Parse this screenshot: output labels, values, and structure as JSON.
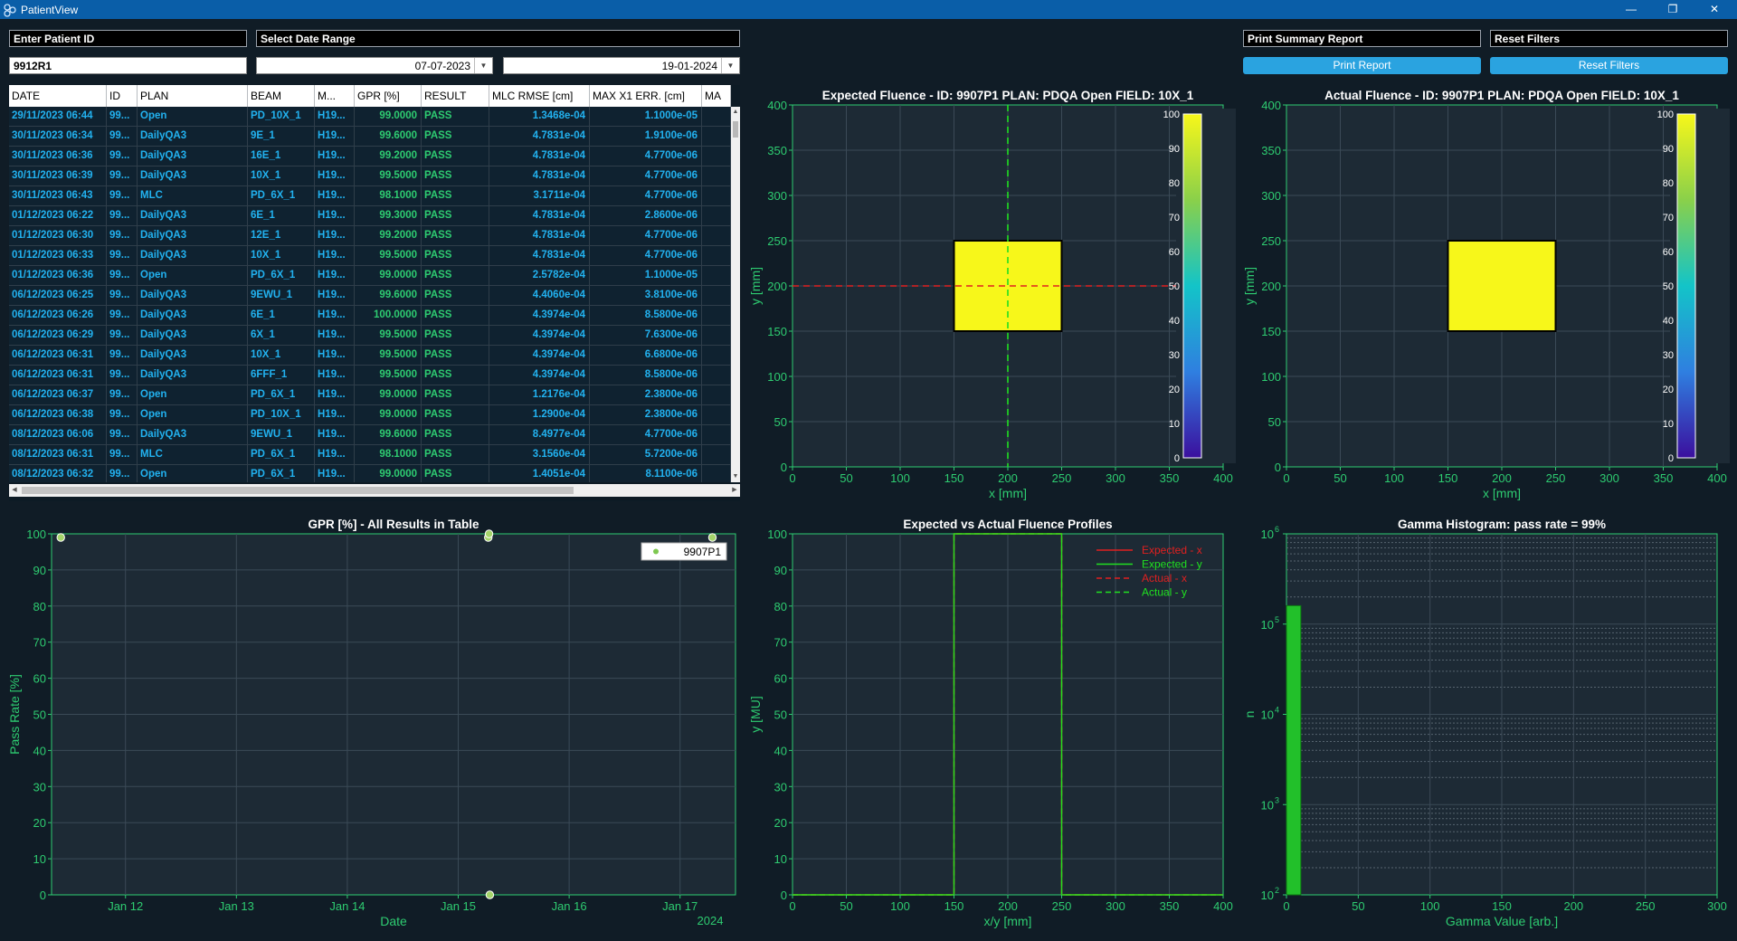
{
  "window": {
    "title": "PatientView"
  },
  "controls": {
    "patient_id_label": "Enter Patient ID",
    "patient_id_value": "9912R1",
    "date_range_label": "Select Date Range",
    "date_start": "07-07-2023",
    "date_end": "19-01-2024",
    "print_summary_label": "Print Summary Report",
    "print_button": "Print Report",
    "reset_label": "Reset Filters",
    "reset_button": "Reset Filters"
  },
  "table": {
    "columns": [
      "DATE",
      "ID",
      "PLAN",
      "BEAM",
      "M...",
      "GPR [%]",
      "RESULT",
      "MLC RMSE [cm]",
      "MAX X1 ERR. [cm]",
      "MA"
    ],
    "rows": [
      [
        "29/11/2023 06:44",
        "99...",
        "Open",
        "PD_10X_1",
        "H19...",
        "99.0000",
        "PASS",
        "1.3468e-04",
        "1.1000e-05"
      ],
      [
        "30/11/2023 06:34",
        "99...",
        "DailyQA3",
        "9E_1",
        "H19...",
        "99.6000",
        "PASS",
        "4.7831e-04",
        "1.9100e-06"
      ],
      [
        "30/11/2023 06:36",
        "99...",
        "DailyQA3",
        "16E_1",
        "H19...",
        "99.2000",
        "PASS",
        "4.7831e-04",
        "4.7700e-06"
      ],
      [
        "30/11/2023 06:39",
        "99...",
        "DailyQA3",
        "10X_1",
        "H19...",
        "99.5000",
        "PASS",
        "4.7831e-04",
        "4.7700e-06"
      ],
      [
        "30/11/2023 06:43",
        "99...",
        "MLC",
        "PD_6X_1",
        "H19...",
        "98.1000",
        "PASS",
        "3.1711e-04",
        "4.7700e-06"
      ],
      [
        "01/12/2023 06:22",
        "99...",
        "DailyQA3",
        "6E_1",
        "H19...",
        "99.3000",
        "PASS",
        "4.7831e-04",
        "2.8600e-06"
      ],
      [
        "01/12/2023 06:30",
        "99...",
        "DailyQA3",
        "12E_1",
        "H19...",
        "99.2000",
        "PASS",
        "4.7831e-04",
        "4.7700e-06"
      ],
      [
        "01/12/2023 06:33",
        "99...",
        "DailyQA3",
        "10X_1",
        "H19...",
        "99.5000",
        "PASS",
        "4.7831e-04",
        "4.7700e-06"
      ],
      [
        "01/12/2023 06:36",
        "99...",
        "Open",
        "PD_6X_1",
        "H19...",
        "99.0000",
        "PASS",
        "2.5782e-04",
        "1.1000e-05"
      ],
      [
        "06/12/2023 06:25",
        "99...",
        "DailyQA3",
        "9EWU_1",
        "H19...",
        "99.6000",
        "PASS",
        "4.4060e-04",
        "3.8100e-06"
      ],
      [
        "06/12/2023 06:26",
        "99...",
        "DailyQA3",
        "6E_1",
        "H19...",
        "100.0000",
        "PASS",
        "4.3974e-04",
        "8.5800e-06"
      ],
      [
        "06/12/2023 06:29",
        "99...",
        "DailyQA3",
        "6X_1",
        "H19...",
        "99.5000",
        "PASS",
        "4.3974e-04",
        "7.6300e-06"
      ],
      [
        "06/12/2023 06:31",
        "99...",
        "DailyQA3",
        "10X_1",
        "H19...",
        "99.5000",
        "PASS",
        "4.3974e-04",
        "6.6800e-06"
      ],
      [
        "06/12/2023 06:31",
        "99...",
        "DailyQA3",
        "6FFF_1",
        "H19...",
        "99.5000",
        "PASS",
        "4.3974e-04",
        "8.5800e-06"
      ],
      [
        "06/12/2023 06:37",
        "99...",
        "Open",
        "PD_6X_1",
        "H19...",
        "99.0000",
        "PASS",
        "1.2176e-04",
        "2.3800e-06"
      ],
      [
        "06/12/2023 06:38",
        "99...",
        "Open",
        "PD_10X_1",
        "H19...",
        "99.0000",
        "PASS",
        "1.2900e-04",
        "2.3800e-06"
      ],
      [
        "08/12/2023 06:06",
        "99...",
        "DailyQA3",
        "9EWU_1",
        "H19...",
        "99.6000",
        "PASS",
        "8.4977e-04",
        "4.7700e-06"
      ],
      [
        "08/12/2023 06:31",
        "99...",
        "MLC",
        "PD_6X_1",
        "H19...",
        "98.1000",
        "PASS",
        "3.1560e-04",
        "5.7200e-06"
      ],
      [
        "08/12/2023 06:32",
        "99...",
        "Open",
        "PD_6X_1",
        "H19...",
        "99.0000",
        "PASS",
        "1.4051e-04",
        "8.1100e-06"
      ]
    ]
  },
  "chart_data": [
    {
      "type": "heatmap",
      "title": "Expected Fluence - ID: 9907P1 PLAN: PDQA Open FIELD: 10X_1",
      "xlabel": "x [mm]",
      "ylabel": "y [mm]",
      "xlim": [
        0,
        400
      ],
      "ylim": [
        0,
        400
      ],
      "xticks": [
        "0",
        "50",
        "100",
        "150",
        "200",
        "250",
        "300",
        "350",
        "400"
      ],
      "yticks": [
        "0",
        "50",
        "100",
        "150",
        "200",
        "250",
        "300",
        "350",
        "400"
      ],
      "field_rect": {
        "x0": 150,
        "x1": 250,
        "y0": 150,
        "y1": 250,
        "value": 100
      },
      "crosshair": {
        "x": 200,
        "y": 200
      },
      "colorbar": {
        "min": 0,
        "max": 100,
        "ticks": [
          "0",
          "10",
          "20",
          "30",
          "40",
          "50",
          "60",
          "70",
          "80",
          "90",
          "100"
        ]
      },
      "grid": true
    },
    {
      "type": "heatmap",
      "title": "Actual Fluence - ID: 9907P1 PLAN: PDQA Open FIELD: 10X_1",
      "xlabel": "x [mm]",
      "ylabel": "y [mm]",
      "xlim": [
        0,
        400
      ],
      "ylim": [
        0,
        400
      ],
      "xticks": [
        "0",
        "50",
        "100",
        "150",
        "200",
        "250",
        "300",
        "350",
        "400"
      ],
      "yticks": [
        "0",
        "50",
        "100",
        "150",
        "200",
        "250",
        "300",
        "350",
        "400"
      ],
      "field_rect": {
        "x0": 150,
        "x1": 250,
        "y0": 150,
        "y1": 250,
        "value": 100
      },
      "colorbar": {
        "min": 0,
        "max": 100,
        "ticks": [
          "0",
          "10",
          "20",
          "30",
          "40",
          "50",
          "60",
          "70",
          "80",
          "90",
          "100"
        ]
      },
      "grid": true
    },
    {
      "type": "scatter",
      "title": "GPR [%] - All Results in Table",
      "xlabel": "Date",
      "ylabel": "Pass Rate [%]",
      "x_range": [
        "2024-01-11 08:00",
        "2024-01-17 12:00"
      ],
      "ylim": [
        0,
        100
      ],
      "xticks": [
        {
          "label": "Jan 12",
          "date": "2024-01-12"
        },
        {
          "label": "Jan 13",
          "date": "2024-01-13"
        },
        {
          "label": "Jan 14",
          "date": "2024-01-14"
        },
        {
          "label": "Jan 15",
          "date": "2024-01-15"
        },
        {
          "label": "Jan 16",
          "date": "2024-01-16"
        },
        {
          "label": "Jan 17",
          "date": "2024-01-17"
        }
      ],
      "x_offset_label": "2024",
      "yticks": [
        "0",
        "10",
        "20",
        "30",
        "40",
        "50",
        "60",
        "70",
        "80",
        "90",
        "100"
      ],
      "series": [
        {
          "name": "9907P1",
          "points": [
            {
              "x": "2024-01-11 10:00",
              "y": 99
            },
            {
              "x": "2024-01-15 06:30",
              "y": 99
            },
            {
              "x": "2024-01-15 06:40",
              "y": 100
            },
            {
              "x": "2024-01-15 06:50",
              "y": 0
            },
            {
              "x": "2024-01-17 07:00",
              "y": 99
            }
          ]
        }
      ],
      "legend": "top-right",
      "grid": true
    },
    {
      "type": "line",
      "title": "Expected vs Actual Fluence Profiles",
      "xlabel": "x/y [mm]",
      "ylabel": "y [MU]",
      "xlim": [
        0,
        400
      ],
      "ylim": [
        0,
        100
      ],
      "xticks": [
        "0",
        "50",
        "100",
        "150",
        "200",
        "250",
        "300",
        "350",
        "400"
      ],
      "yticks": [
        "0",
        "10",
        "20",
        "30",
        "40",
        "50",
        "60",
        "70",
        "80",
        "90",
        "100"
      ],
      "series": [
        {
          "name": "Expected - x",
          "color": "#e02020",
          "dash": false,
          "x": [
            0,
            150,
            150,
            250,
            250,
            400
          ],
          "y": [
            0,
            0,
            100,
            100,
            0,
            0
          ]
        },
        {
          "name": "Expected - y",
          "color": "#20e020",
          "dash": false,
          "x": [
            0,
            150,
            150,
            250,
            250,
            400
          ],
          "y": [
            0,
            0,
            100,
            100,
            0,
            0
          ]
        },
        {
          "name": "Actual - x",
          "color": "#e02020",
          "dash": true,
          "x": [
            0,
            150,
            150,
            250,
            250,
            400
          ],
          "y": [
            0,
            0,
            100,
            100,
            0,
            0
          ]
        },
        {
          "name": "Actual - y",
          "color": "#20e020",
          "dash": true,
          "x": [
            0,
            150,
            150,
            250,
            250,
            400
          ],
          "y": [
            0,
            0,
            100,
            100,
            0,
            0
          ]
        }
      ],
      "legend": "top-right",
      "grid": true
    },
    {
      "type": "bar",
      "title": "Gamma Histogram: pass rate = 99%",
      "xlabel": "Gamma Value [arb.]",
      "ylabel": "n",
      "xlim": [
        0,
        300
      ],
      "y_scale": "log",
      "ylim": [
        100,
        1000000
      ],
      "xticks": [
        "0",
        "50",
        "100",
        "150",
        "200",
        "250",
        "300"
      ],
      "yticks": [
        {
          "base": "10",
          "exp": "2",
          "value": 100
        },
        {
          "base": "10",
          "exp": "3",
          "value": 1000
        },
        {
          "base": "10",
          "exp": "4",
          "value": 10000
        },
        {
          "base": "10",
          "exp": "5",
          "value": 100000
        },
        {
          "base": "10",
          "exp": "6",
          "value": 1000000
        }
      ],
      "bars": [
        {
          "x0": 0,
          "x1": 10,
          "n": 160000
        }
      ],
      "grid": true
    }
  ],
  "colors": {
    "accent": "#2aa3e0",
    "plot_bg": "#1d2a35",
    "axis_green": "#2ecc71",
    "table_text_blue": "#22b2f0",
    "field_yellow": "#f7f71a"
  }
}
